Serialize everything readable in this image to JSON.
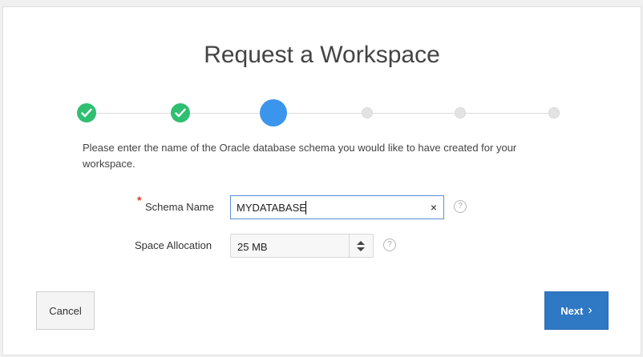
{
  "dialog": {
    "title": "Request a Workspace",
    "instructions": "Please enter the name of the Oracle database schema you would like to have created for your workspace."
  },
  "wizard": {
    "steps": [
      {
        "state": "complete"
      },
      {
        "state": "complete"
      },
      {
        "state": "current"
      },
      {
        "state": "pending"
      },
      {
        "state": "pending"
      },
      {
        "state": "pending"
      }
    ],
    "current_step": 3,
    "total_steps": 6
  },
  "form": {
    "schema_name": {
      "required_marker": "*",
      "label": "Schema Name",
      "value": "MYDATABASE",
      "clear_icon": "×",
      "help_icon": "?"
    },
    "space_allocation": {
      "label": "Space Allocation",
      "value": "25 MB",
      "help_icon": "?"
    }
  },
  "buttons": {
    "cancel_label": "Cancel",
    "next_label": "Next",
    "next_icon": "›"
  },
  "colors": {
    "complete": "#2fbf71",
    "current": "#3b95ec",
    "pending": "#e3e3e3",
    "primary_button": "#2f78c4",
    "required": "#e2372d"
  }
}
